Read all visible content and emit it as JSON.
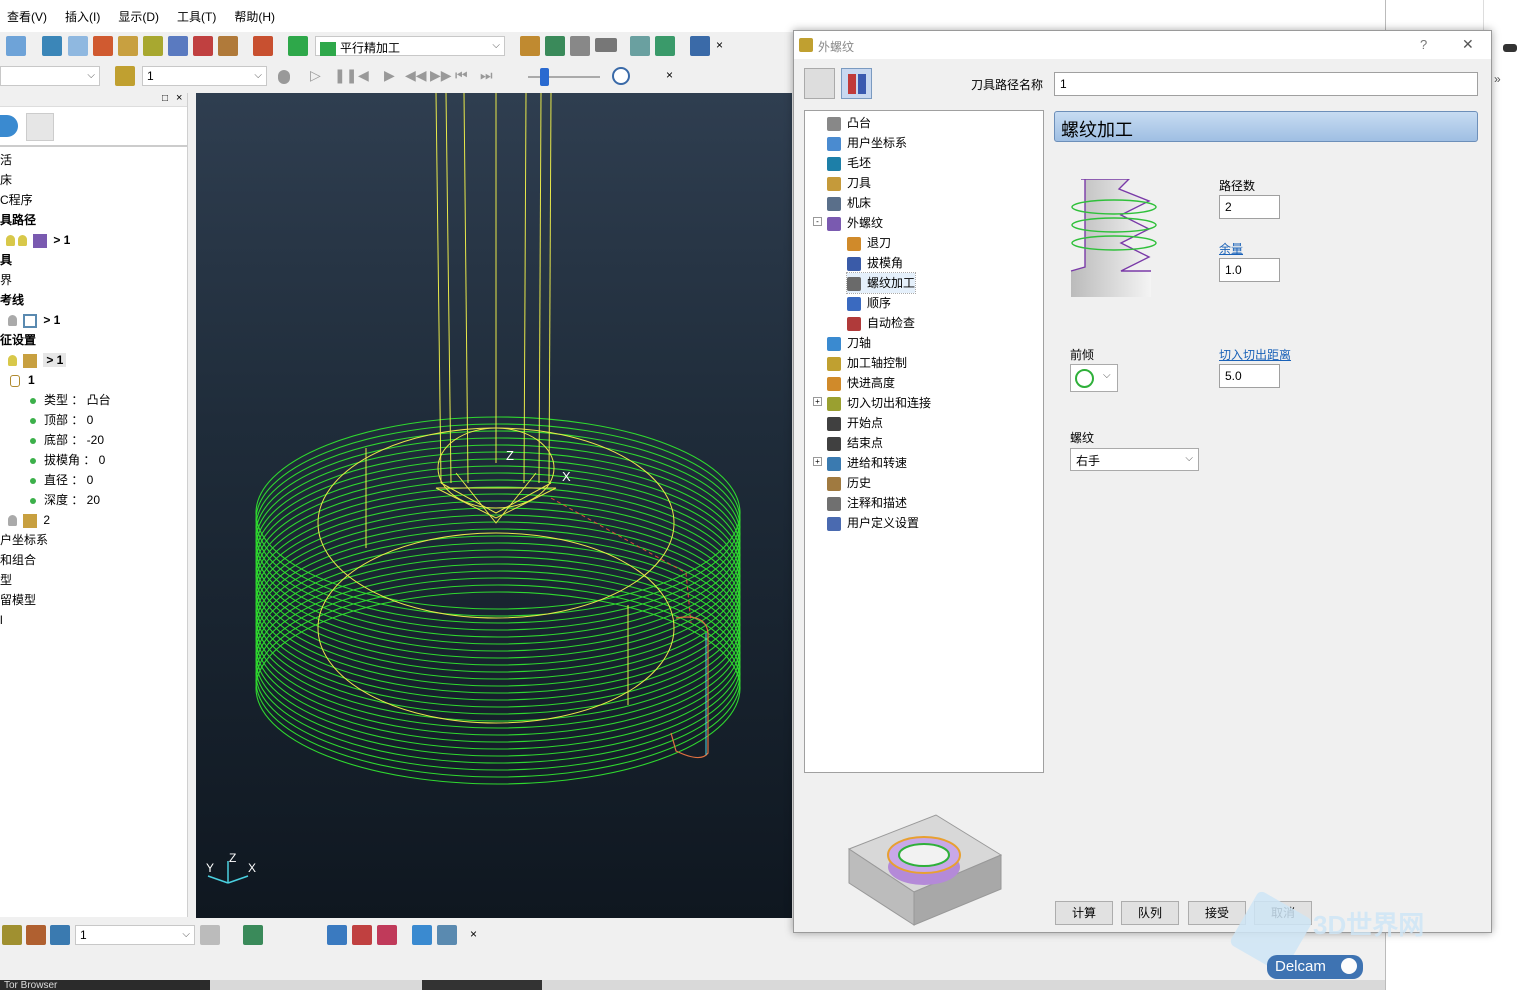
{
  "menu": [
    "查看(V)",
    "插入(I)",
    "显示(D)",
    "工具(T)",
    "帮助(H)"
  ],
  "toolbar": {
    "strategy_label": "平行精加工",
    "toolpath_value": "1"
  },
  "explorer": {
    "rows": [
      {
        "text": "活",
        "bold": false
      },
      {
        "text": "床",
        "bold": false
      },
      {
        "text": "C程序",
        "bold": false
      },
      {
        "text": "具路径",
        "bold": true
      },
      {
        "text": "> 1",
        "bold": true
      },
      {
        "text": "具",
        "bold": true
      },
      {
        "text": "界",
        "bold": false
      },
      {
        "text": "考线",
        "bold": true
      },
      {
        "text": "> 1",
        "bold": true
      },
      {
        "text": "征设置",
        "bold": true
      },
      {
        "text": "> 1",
        "bold": true
      },
      {
        "text": "1",
        "bold": true
      },
      {
        "text": "类型 ： 凸台",
        "bold": false
      },
      {
        "text": "顶部 ： 0",
        "bold": false
      },
      {
        "text": "底部 ： -20",
        "bold": false
      },
      {
        "text": "拔模角 ： 0",
        "bold": false
      },
      {
        "text": "直径 ： 0",
        "bold": false
      },
      {
        "text": "深度 ： 20",
        "bold": false
      },
      {
        "text": "2",
        "bold": false
      },
      {
        "text": "户坐标系",
        "bold": false
      },
      {
        "text": "和组合",
        "bold": false
      },
      {
        "text": "型",
        "bold": false
      },
      {
        "text": "留模型",
        "bold": false
      },
      {
        "text": "l",
        "bold": false
      }
    ]
  },
  "viewport": {
    "axis_labels": {
      "x": "X",
      "y": "Y",
      "z": "Z"
    }
  },
  "bottombar": {
    "value": "1"
  },
  "taskbar": {
    "item": "Tor Browser"
  },
  "dialog": {
    "title": "外螺纹",
    "help": "?",
    "close": "✕",
    "path_name_label": "刀具路径名称",
    "path_name_value": "1",
    "page_title": "螺纹加工",
    "tree": [
      {
        "label": "凸台",
        "indent": 0,
        "color": "#888"
      },
      {
        "label": "用户坐标系",
        "indent": 0,
        "color": "#4a8bd0"
      },
      {
        "label": "毛坯",
        "indent": 0,
        "color": "#1d7fa8"
      },
      {
        "label": "刀具",
        "indent": 0,
        "color": "#c59a3a"
      },
      {
        "label": "机床",
        "indent": 0,
        "color": "#5a6f8a"
      },
      {
        "label": "外螺纹",
        "indent": 0,
        "color": "#7a5ab0"
      },
      {
        "label": "退刀",
        "indent": 1,
        "color": "#d08a2a"
      },
      {
        "label": "拔模角",
        "indent": 1,
        "color": "#3a5ba8"
      },
      {
        "label": "螺纹加工",
        "indent": 1,
        "color": "#6a6a6a"
      },
      {
        "label": "顺序",
        "indent": 1,
        "color": "#3a6ac0"
      },
      {
        "label": "自动检查",
        "indent": 1,
        "color": "#b03a3a"
      },
      {
        "label": "刀轴",
        "indent": 0,
        "color": "#3a8ad0"
      },
      {
        "label": "加工轴控制",
        "indent": 0,
        "color": "#c0a030"
      },
      {
        "label": "快进高度",
        "indent": 0,
        "color": "#d08a2a"
      },
      {
        "label": "切入切出和连接",
        "indent": 0,
        "color": "#9aa030"
      },
      {
        "label": "开始点",
        "indent": 0,
        "color": "#404040"
      },
      {
        "label": "结束点",
        "indent": 0,
        "color": "#404040"
      },
      {
        "label": "进给和转速",
        "indent": 0,
        "color": "#3a7ab0"
      },
      {
        "label": "历史",
        "indent": 0,
        "color": "#a07a40"
      },
      {
        "label": "注释和描述",
        "indent": 0,
        "color": "#707070"
      },
      {
        "label": "用户定义设置",
        "indent": 0,
        "color": "#4a6ab0"
      }
    ],
    "passes_label": "路径数",
    "passes_value": "2",
    "allowance_label": "余量",
    "allowance_value": "1.0",
    "rake_label": "前倾",
    "lead_dist_label": "切入切出距离",
    "lead_dist_value": "5.0",
    "thread_label": "螺纹",
    "thread_value": "右手",
    "buttons": {
      "calc": "计算",
      "queue": "队列",
      "accept": "接受",
      "cancel": "取消"
    }
  },
  "watermark": {
    "brand": "Delcam",
    "site": "3D世界网"
  }
}
